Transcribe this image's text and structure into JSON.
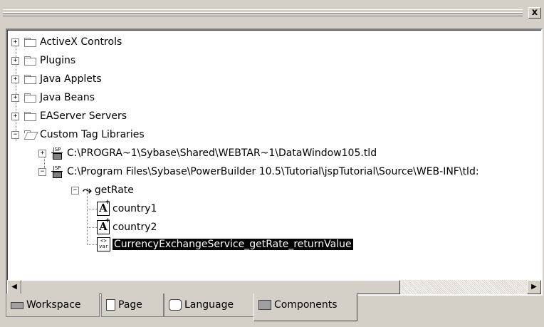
{
  "window": {
    "close_glyph": "x"
  },
  "tree": {
    "nodes": [
      {
        "label": "ActiveX Controls",
        "expander": "+"
      },
      {
        "label": "Plugins",
        "expander": "+"
      },
      {
        "label": "Java Applets",
        "expander": "+"
      },
      {
        "label": "Java Beans",
        "expander": "+"
      },
      {
        "label": "EAServer Servers",
        "expander": "+"
      },
      {
        "label": "Custom Tag Libraries",
        "expander": "−"
      },
      {
        "label": "C:\\PROGRA~1\\Sybase\\Shared\\WEBTAR~1\\DataWindow105.tld",
        "expander": "+"
      },
      {
        "label": "C:\\Program Files\\Sybase\\PowerBuilder 10.5\\Tutorial\\jspTutorial\\Source\\WEB-INF\\tld:",
        "expander": "−"
      },
      {
        "label": "getRate",
        "expander": "−"
      },
      {
        "label": "country1"
      },
      {
        "label": "country2"
      },
      {
        "label": "CurrencyExchangeService_getRate_returnValue"
      }
    ],
    "jsp_icon_text": "JSP",
    "var_icon_text": "var",
    "attr_icon_text": "A"
  },
  "scrollbar": {
    "left_arrow": "◀",
    "right_arrow": "▶"
  },
  "tabs": [
    {
      "label": "Workspace",
      "icon": "workspace-icon"
    },
    {
      "label": "Page",
      "icon": "page-icon"
    },
    {
      "label": "Language",
      "icon": "language-icon"
    },
    {
      "label": "Components",
      "icon": "components-icon",
      "active": true
    }
  ]
}
